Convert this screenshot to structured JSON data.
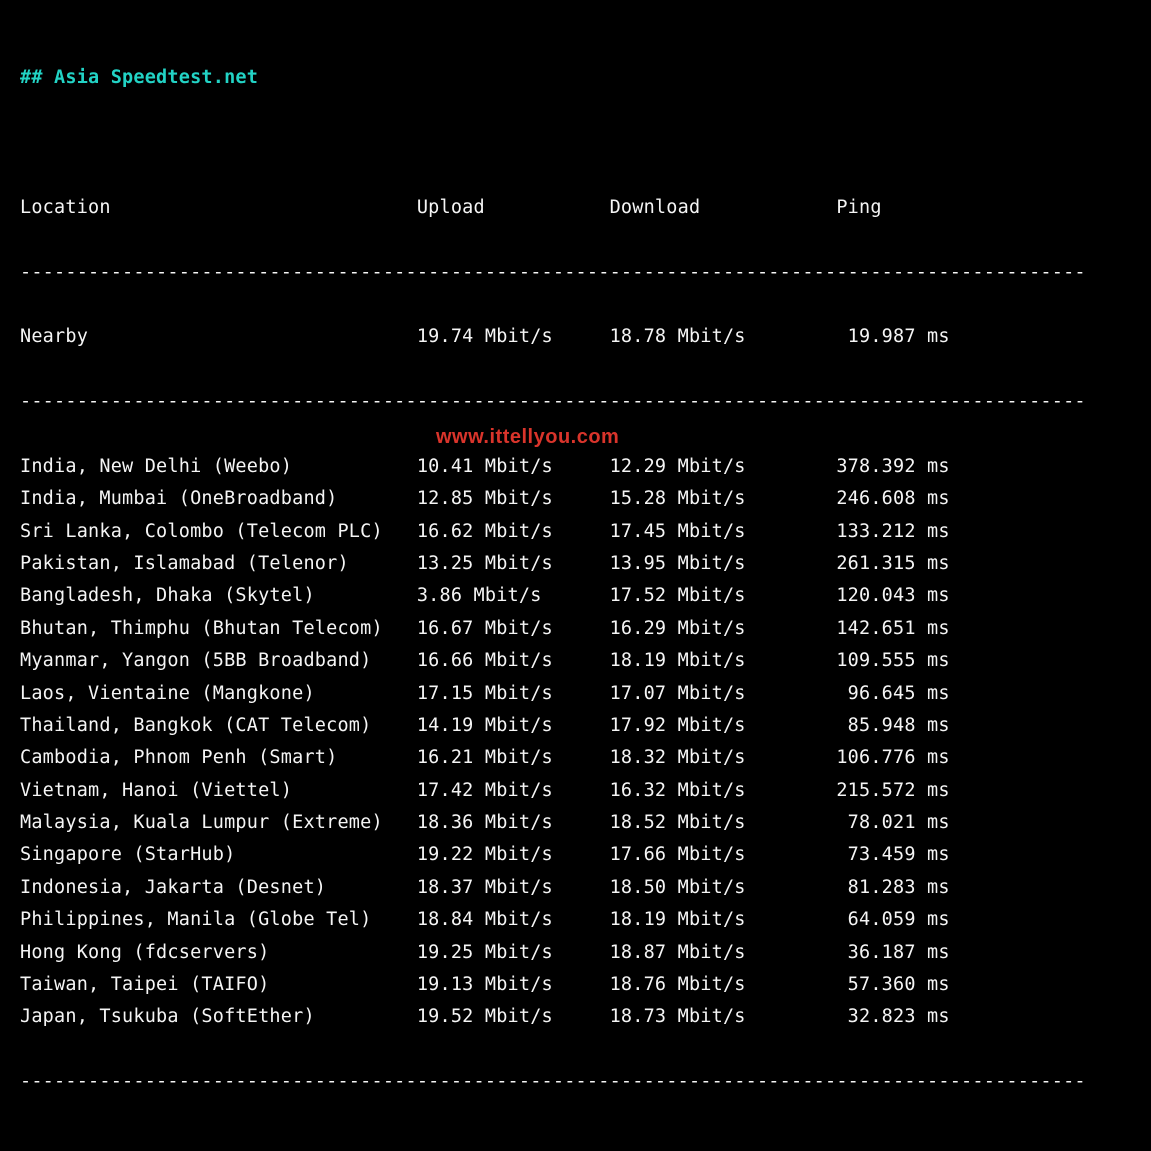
{
  "title": "## Asia Speedtest.net",
  "headers": {
    "location": "Location",
    "upload": "Upload",
    "download": "Download",
    "ping": "Ping"
  },
  "divider_width": 94,
  "nearby": {
    "location": "Nearby",
    "upload": "19.74 Mbit/s",
    "download": "18.78 Mbit/s",
    "ping": "19.987 ms"
  },
  "rows": [
    {
      "location": "India, New Delhi (Weebo)",
      "upload": "10.41 Mbit/s",
      "download": "12.29 Mbit/s",
      "ping": "378.392 ms"
    },
    {
      "location": "India, Mumbai (OneBroadband)",
      "upload": "12.85 Mbit/s",
      "download": "15.28 Mbit/s",
      "ping": "246.608 ms"
    },
    {
      "location": "Sri Lanka, Colombo (Telecom PLC)",
      "upload": "16.62 Mbit/s",
      "download": "17.45 Mbit/s",
      "ping": "133.212 ms"
    },
    {
      "location": "Pakistan, Islamabad (Telenor)",
      "upload": "13.25 Mbit/s",
      "download": "13.95 Mbit/s",
      "ping": "261.315 ms"
    },
    {
      "location": "Bangladesh, Dhaka (Skytel)",
      "upload": "3.86 Mbit/s",
      "download": "17.52 Mbit/s",
      "ping": "120.043 ms"
    },
    {
      "location": "Bhutan, Thimphu (Bhutan Telecom)",
      "upload": "16.67 Mbit/s",
      "download": "16.29 Mbit/s",
      "ping": "142.651 ms"
    },
    {
      "location": "Myanmar, Yangon (5BB Broadband)",
      "upload": "16.66 Mbit/s",
      "download": "18.19 Mbit/s",
      "ping": "109.555 ms"
    },
    {
      "location": "Laos, Vientaine (Mangkone)",
      "upload": "17.15 Mbit/s",
      "download": "17.07 Mbit/s",
      "ping": "96.645 ms"
    },
    {
      "location": "Thailand, Bangkok (CAT Telecom)",
      "upload": "14.19 Mbit/s",
      "download": "17.92 Mbit/s",
      "ping": "85.948 ms"
    },
    {
      "location": "Cambodia, Phnom Penh (Smart)",
      "upload": "16.21 Mbit/s",
      "download": "18.32 Mbit/s",
      "ping": "106.776 ms"
    },
    {
      "location": "Vietnam, Hanoi (Viettel)",
      "upload": "17.42 Mbit/s",
      "download": "16.32 Mbit/s",
      "ping": "215.572 ms"
    },
    {
      "location": "Malaysia, Kuala Lumpur (Extreme)",
      "upload": "18.36 Mbit/s",
      "download": "18.52 Mbit/s",
      "ping": "78.021 ms"
    },
    {
      "location": "Singapore (StarHub)",
      "upload": "19.22 Mbit/s",
      "download": "17.66 Mbit/s",
      "ping": "73.459 ms"
    },
    {
      "location": "Indonesia, Jakarta (Desnet)",
      "upload": "18.37 Mbit/s",
      "download": "18.50 Mbit/s",
      "ping": "81.283 ms"
    },
    {
      "location": "Philippines, Manila (Globe Tel)",
      "upload": "18.84 Mbit/s",
      "download": "18.19 Mbit/s",
      "ping": "64.059 ms"
    },
    {
      "location": "Hong Kong (fdcservers)",
      "upload": "19.25 Mbit/s",
      "download": "18.87 Mbit/s",
      "ping": "36.187 ms"
    },
    {
      "location": "Taiwan, Taipei (TAIFO)",
      "upload": "19.13 Mbit/s",
      "download": "18.76 Mbit/s",
      "ping": "57.360 ms"
    },
    {
      "location": "Japan, Tsukuba (SoftEther)",
      "upload": "19.52 Mbit/s",
      "download": "18.73 Mbit/s",
      "ping": "32.823 ms"
    }
  ],
  "watermark": "www.ittellyou.com",
  "chart_data": {
    "type": "table",
    "title": "Asia Speedtest.net",
    "columns": [
      "Location",
      "Upload (Mbit/s)",
      "Download (Mbit/s)",
      "Ping (ms)"
    ],
    "nearby": {
      "location": "Nearby",
      "upload": 19.74,
      "download": 18.78,
      "ping": 19.987
    },
    "data": [
      {
        "location": "India, New Delhi (Weebo)",
        "upload": 10.41,
        "download": 12.29,
        "ping": 378.392
      },
      {
        "location": "India, Mumbai (OneBroadband)",
        "upload": 12.85,
        "download": 15.28,
        "ping": 246.608
      },
      {
        "location": "Sri Lanka, Colombo (Telecom PLC)",
        "upload": 16.62,
        "download": 17.45,
        "ping": 133.212
      },
      {
        "location": "Pakistan, Islamabad (Telenor)",
        "upload": 13.25,
        "download": 13.95,
        "ping": 261.315
      },
      {
        "location": "Bangladesh, Dhaka (Skytel)",
        "upload": 3.86,
        "download": 17.52,
        "ping": 120.043
      },
      {
        "location": "Bhutan, Thimphu (Bhutan Telecom)",
        "upload": 16.67,
        "download": 16.29,
        "ping": 142.651
      },
      {
        "location": "Myanmar, Yangon (5BB Broadband)",
        "upload": 16.66,
        "download": 18.19,
        "ping": 109.555
      },
      {
        "location": "Laos, Vientaine (Mangkone)",
        "upload": 17.15,
        "download": 17.07,
        "ping": 96.645
      },
      {
        "location": "Thailand, Bangkok (CAT Telecom)",
        "upload": 14.19,
        "download": 17.92,
        "ping": 85.948
      },
      {
        "location": "Cambodia, Phnom Penh (Smart)",
        "upload": 16.21,
        "download": 18.32,
        "ping": 106.776
      },
      {
        "location": "Vietnam, Hanoi (Viettel)",
        "upload": 17.42,
        "download": 16.32,
        "ping": 215.572
      },
      {
        "location": "Malaysia, Kuala Lumpur (Extreme)",
        "upload": 18.36,
        "download": 18.52,
        "ping": 78.021
      },
      {
        "location": "Singapore (StarHub)",
        "upload": 19.22,
        "download": 17.66,
        "ping": 73.459
      },
      {
        "location": "Indonesia, Jakarta (Desnet)",
        "upload": 18.37,
        "download": 18.5,
        "ping": 81.283
      },
      {
        "location": "Philippines, Manila (Globe Tel)",
        "upload": 18.84,
        "download": 18.19,
        "ping": 64.059
      },
      {
        "location": "Hong Kong (fdcservers)",
        "upload": 19.25,
        "download": 18.87,
        "ping": 36.187
      },
      {
        "location": "Taiwan, Taipei (TAIFO)",
        "upload": 19.13,
        "download": 18.76,
        "ping": 57.36
      },
      {
        "location": "Japan, Tsukuba (SoftEther)",
        "upload": 19.52,
        "download": 18.73,
        "ping": 32.823
      }
    ]
  }
}
